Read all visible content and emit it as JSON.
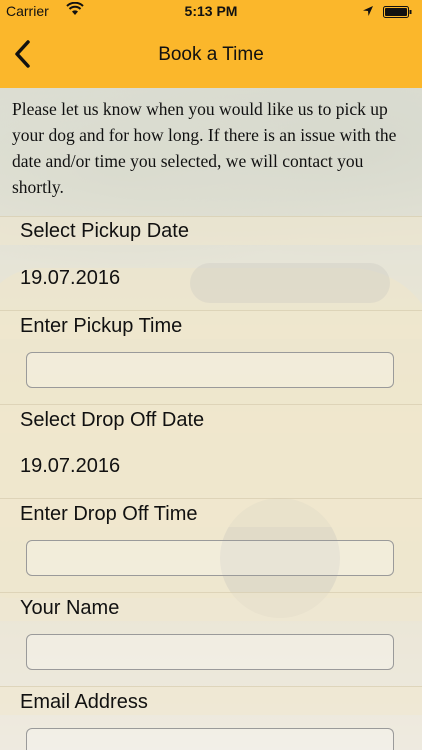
{
  "status": {
    "carrier": "Carrier",
    "time": "5:13 PM"
  },
  "nav": {
    "title": "Book a Time"
  },
  "intro": "Please let us know when you would like us to pick up your dog and for how long. If there is an issue with the date and/or time you selected, we will contact you shortly.",
  "form": {
    "pickup_date_label": "Select Pickup Date",
    "pickup_date_value": "19.07.2016",
    "pickup_time_label": "Enter Pickup Time",
    "dropoff_date_label": "Select Drop Off Date",
    "dropoff_date_value": "19.07.2016",
    "dropoff_time_label": "Enter Drop Off Time",
    "name_label": "Your Name",
    "email_label": "Email Address"
  },
  "colors": {
    "accent": "#fbb72b"
  }
}
